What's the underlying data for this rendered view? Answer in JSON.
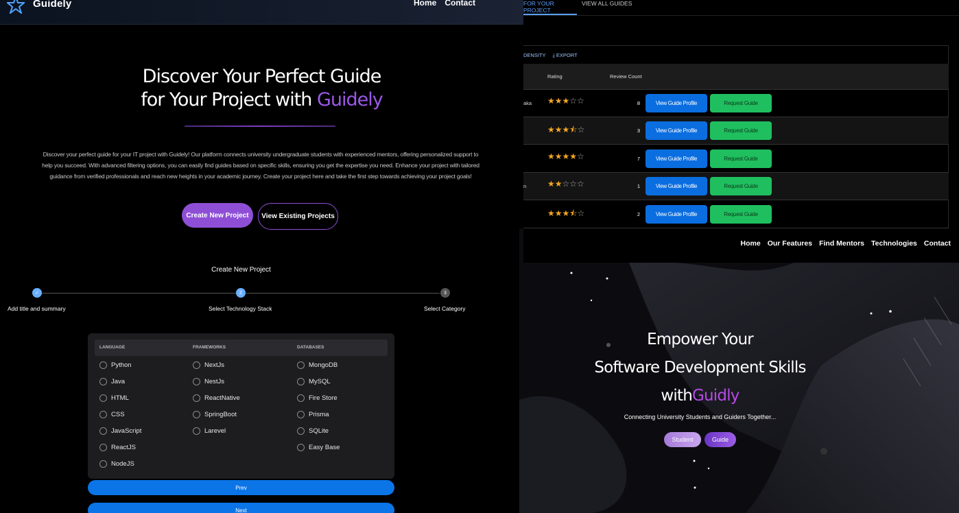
{
  "left": {
    "brand": "Guidely",
    "nav": [
      "Home",
      "Contact"
    ],
    "hero": {
      "line1": "Discover Your Perfect Guide",
      "line2_prefix": "for Your Project with ",
      "line2_accent": "Guidely"
    },
    "description": "Discover your perfect guide for your IT project with Guidely! Our platform connects university undergraduate students with experienced mentors, offering personalized support to help you succeed. With advanced filtering options, you can easily find guides based on specific skills, ensuring you get the expertise you need. Enhance your project with tailored guidance from verified professionals and reach new heights in your academic journey. Create your project here and take the first step towards achieving your project goals!",
    "buttons": {
      "create": "Create New Project",
      "view": "View Existing Projects"
    },
    "wizard": {
      "title": "Create New Project",
      "steps": [
        {
          "num": "✓",
          "label": "Add title and summary"
        },
        {
          "num": "2",
          "label": "Select Technology Stack"
        },
        {
          "num": "3",
          "label": "Select Category"
        }
      ],
      "columns": {
        "language": "LANGUAGE",
        "frameworks": "FRAMEWORKS",
        "databases": "DATABASES"
      },
      "language": [
        "Python",
        "Java",
        "HTML",
        "CSS",
        "JavaScript",
        "ReactJS",
        "NodeJS"
      ],
      "frameworks": [
        "NextJs",
        "NestJs",
        "ReactNative",
        "SpringBoot",
        "Larevel"
      ],
      "databases": [
        "MongoDB",
        "MySQL",
        "Fire Store",
        "Prisma",
        "SQLite",
        "Easy Base"
      ],
      "prev": "Prev",
      "next": "Next"
    }
  },
  "guides": {
    "tabs": [
      "FOR YOUR PROJECT",
      "VIEW ALL GUIDES"
    ],
    "toolbar": [
      "DENSITY",
      "EXPORT"
    ],
    "headers": {
      "rating": "Rating",
      "review_count": "Review Count"
    },
    "rows": [
      {
        "name": "aka",
        "rating": 3,
        "half": false,
        "stars": "★★★",
        "empty": "☆☆",
        "count": "8"
      },
      {
        "name": "",
        "rating": 3.5,
        "half": true,
        "stars": "★★★⯪",
        "empty": "☆",
        "count": "3"
      },
      {
        "name": "",
        "rating": 4,
        "half": false,
        "stars": "★★★★",
        "empty": "☆",
        "count": "7"
      },
      {
        "name": "n",
        "rating": 2,
        "half": false,
        "stars": "★★",
        "empty": "☆☆☆",
        "count": "1"
      },
      {
        "name": "",
        "rating": 3.5,
        "half": true,
        "stars": "★★★⯪",
        "empty": "☆",
        "count": "2"
      }
    ],
    "profile_btn": "View Guide Profile",
    "request_btn": "Request Guide"
  },
  "landing": {
    "nav": [
      "Home",
      "Our Features",
      "Find Mentors",
      "Technologies",
      "Contact"
    ],
    "title1": "Empower Your",
    "title2": "Software Development Skills",
    "title3_prefix": "with",
    "title3_accent": "Guidly",
    "subtitle": "Connecting University Students and Guiders Together...",
    "student": "Student",
    "guide": "Guide"
  },
  "colors": {
    "accent": "#8e4fd6",
    "primary_blue": "#0b75e8",
    "green": "#1fbf5f",
    "star": "#f5a623"
  }
}
